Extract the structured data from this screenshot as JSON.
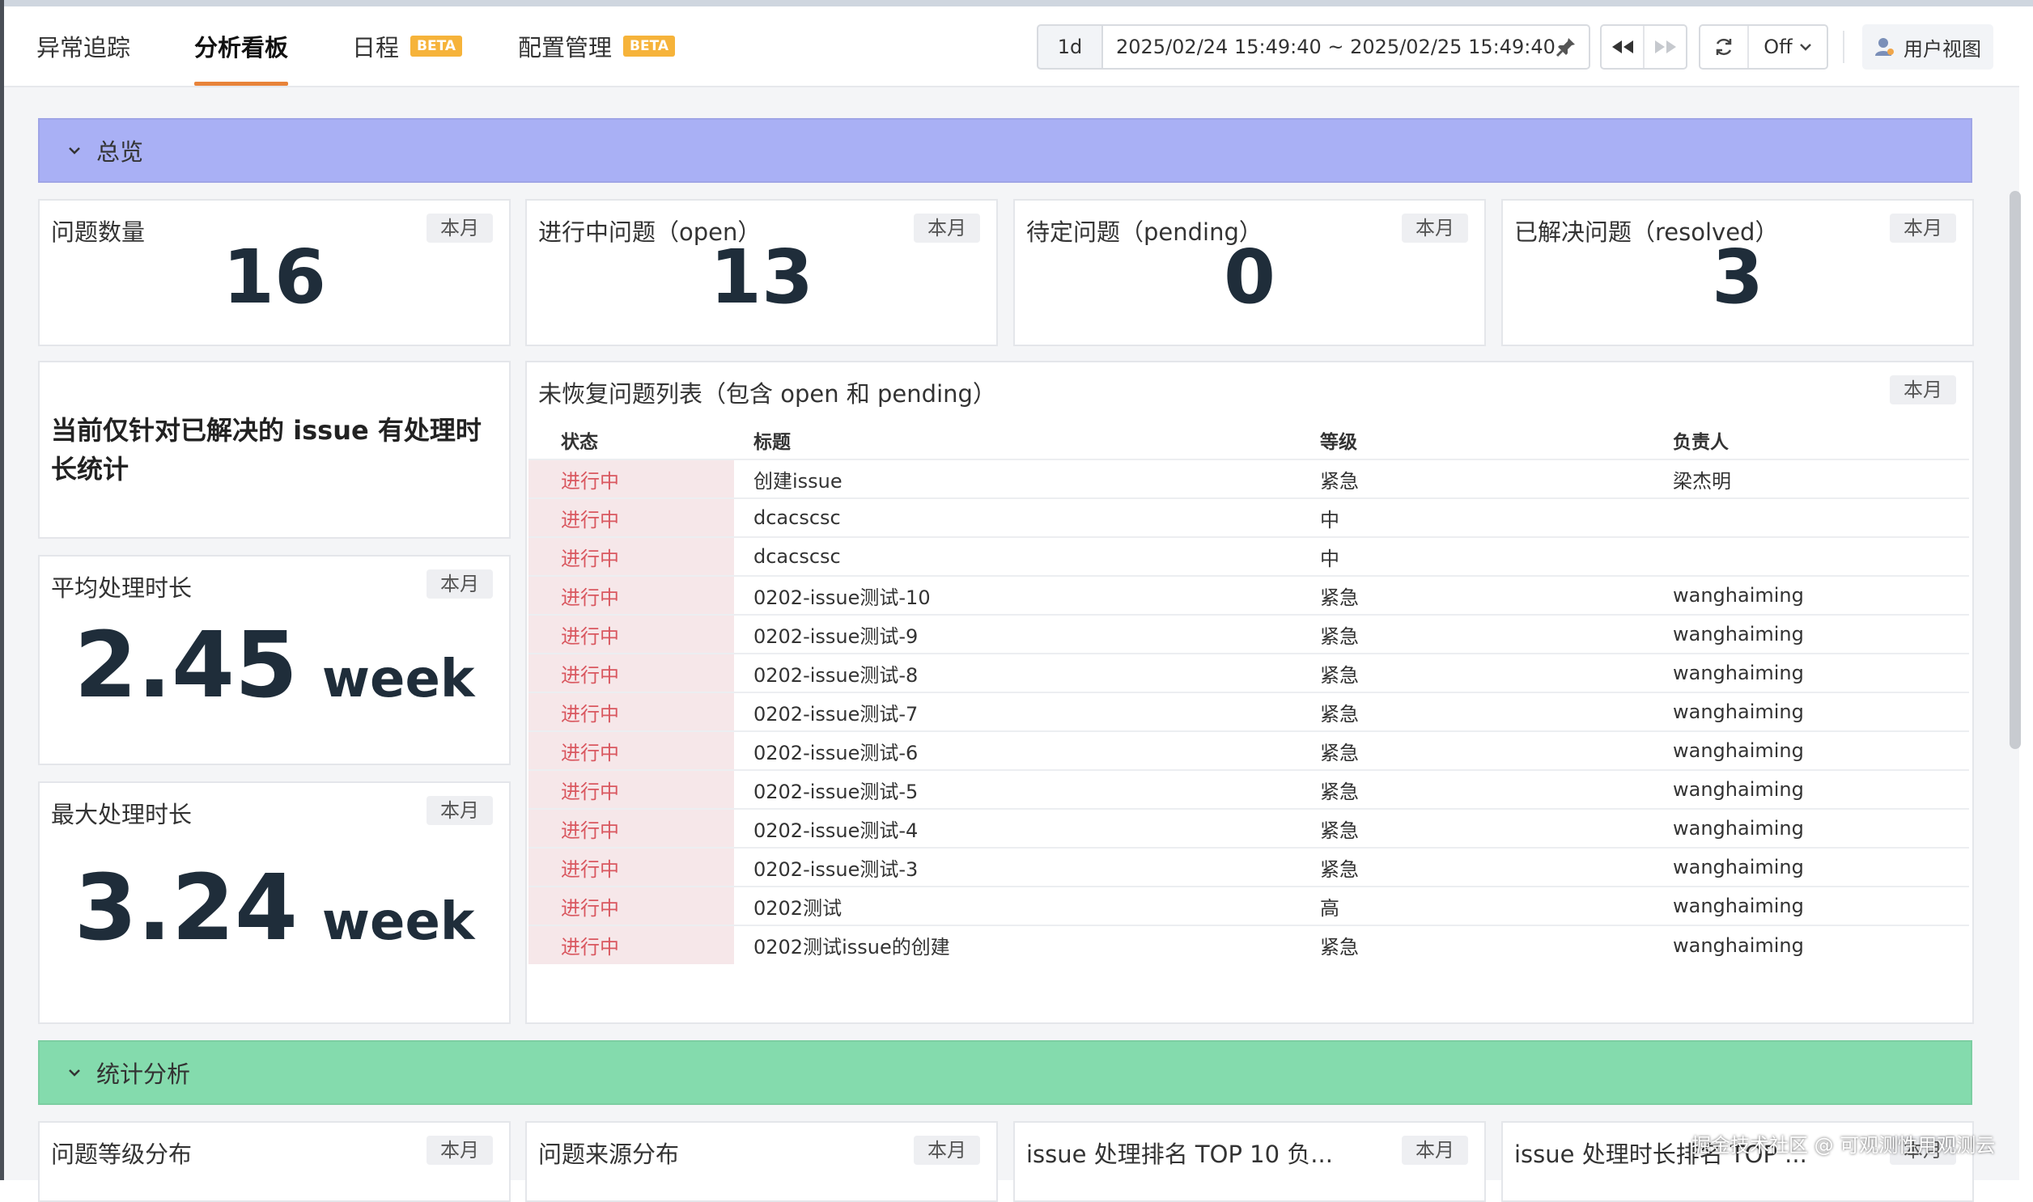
{
  "header": {
    "tabs": [
      {
        "label": "异常追踪",
        "beta": ""
      },
      {
        "label": "分析看板",
        "beta": ""
      },
      {
        "label": "日程",
        "beta": "BETA"
      },
      {
        "label": "配置管理",
        "beta": "BETA"
      }
    ],
    "active_tab": "分析看板",
    "time_period": "1d",
    "time_range": "2025/02/24 15:49:40 ~ 2025/02/25 15:49:40",
    "refresh": "Off",
    "user_view": "用户视图"
  },
  "sections": {
    "overview": "总览",
    "stats": "统计分析"
  },
  "scope_badge": "本月",
  "kpis": [
    {
      "title": "问题数量",
      "value": "16"
    },
    {
      "title": "进行中问题（open）",
      "value": "13"
    },
    {
      "title": "待定问题（pending）",
      "value": "0"
    },
    {
      "title": "已解决问题（resolved）",
      "value": "3"
    }
  ],
  "notice": "当前仅针对已解决的 issue 有处理时长统计",
  "durations": {
    "avg": {
      "title": "平均处理时长",
      "value": "2.45",
      "unit": "week"
    },
    "max": {
      "title": "最大处理时长",
      "value": "3.24",
      "unit": "week"
    }
  },
  "issue_table": {
    "title": "未恢复问题列表（包含 open 和 pending）",
    "columns": [
      "状态",
      "标题",
      "等级",
      "负责人"
    ],
    "rows": [
      [
        "进行中",
        "创建issue",
        "紧急",
        "梁杰明"
      ],
      [
        "进行中",
        "dcacscsc",
        "中",
        ""
      ],
      [
        "进行中",
        "dcacscsc",
        "中",
        ""
      ],
      [
        "进行中",
        "0202-issue测试-10",
        "紧急",
        "wanghaiming"
      ],
      [
        "进行中",
        "0202-issue测试-9",
        "紧急",
        "wanghaiming"
      ],
      [
        "进行中",
        "0202-issue测试-8",
        "紧急",
        "wanghaiming"
      ],
      [
        "进行中",
        "0202-issue测试-7",
        "紧急",
        "wanghaiming"
      ],
      [
        "进行中",
        "0202-issue测试-6",
        "紧急",
        "wanghaiming"
      ],
      [
        "进行中",
        "0202-issue测试-5",
        "紧急",
        "wanghaiming"
      ],
      [
        "进行中",
        "0202-issue测试-4",
        "紧急",
        "wanghaiming"
      ],
      [
        "进行中",
        "0202-issue测试-3",
        "紧急",
        "wanghaiming"
      ],
      [
        "进行中",
        "0202测试",
        "高",
        "wanghaiming"
      ],
      [
        "进行中",
        "0202测试issue的创建",
        "紧急",
        "wanghaiming"
      ]
    ]
  },
  "bottom_cards": [
    "问题等级分布",
    "问题来源分布",
    "issue 处理排名 TOP 10 负...",
    "issue 处理时长排名 TOP ..."
  ],
  "watermark": "掘金技术社区 @ 可观测性用观测云",
  "colors": {
    "overview_bar": "#a9b0f5",
    "stats_bar": "#84dbad",
    "active_tab_underline": "#e8833a",
    "beta_badge": "#f6b33a",
    "status_text": "#d9575f"
  }
}
